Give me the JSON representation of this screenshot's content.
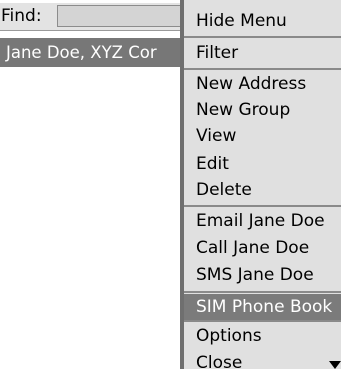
{
  "find": {
    "label": "Find:",
    "value": ""
  },
  "contacts": [
    {
      "label": "Jane Doe, XYZ Cor"
    }
  ],
  "menu": {
    "items": [
      {
        "label": "Hide Menu"
      },
      {
        "label": "Filter"
      },
      {
        "label": "New Address"
      },
      {
        "label": "New Group"
      },
      {
        "label": "View"
      },
      {
        "label": "Edit"
      },
      {
        "label": "Delete"
      },
      {
        "label": "Email Jane Doe"
      },
      {
        "label": "Call Jane Doe"
      },
      {
        "label": "SMS Jane Doe"
      },
      {
        "label": "SIM Phone Book"
      },
      {
        "label": "Options"
      },
      {
        "label": "Close"
      }
    ],
    "selected_index": 10,
    "scroll_icon": "chevron-down-icon"
  },
  "colors": {
    "selection": "#7b7b7b",
    "menu_bg": "#e0e0e0",
    "divider": "#6f6f6f"
  }
}
